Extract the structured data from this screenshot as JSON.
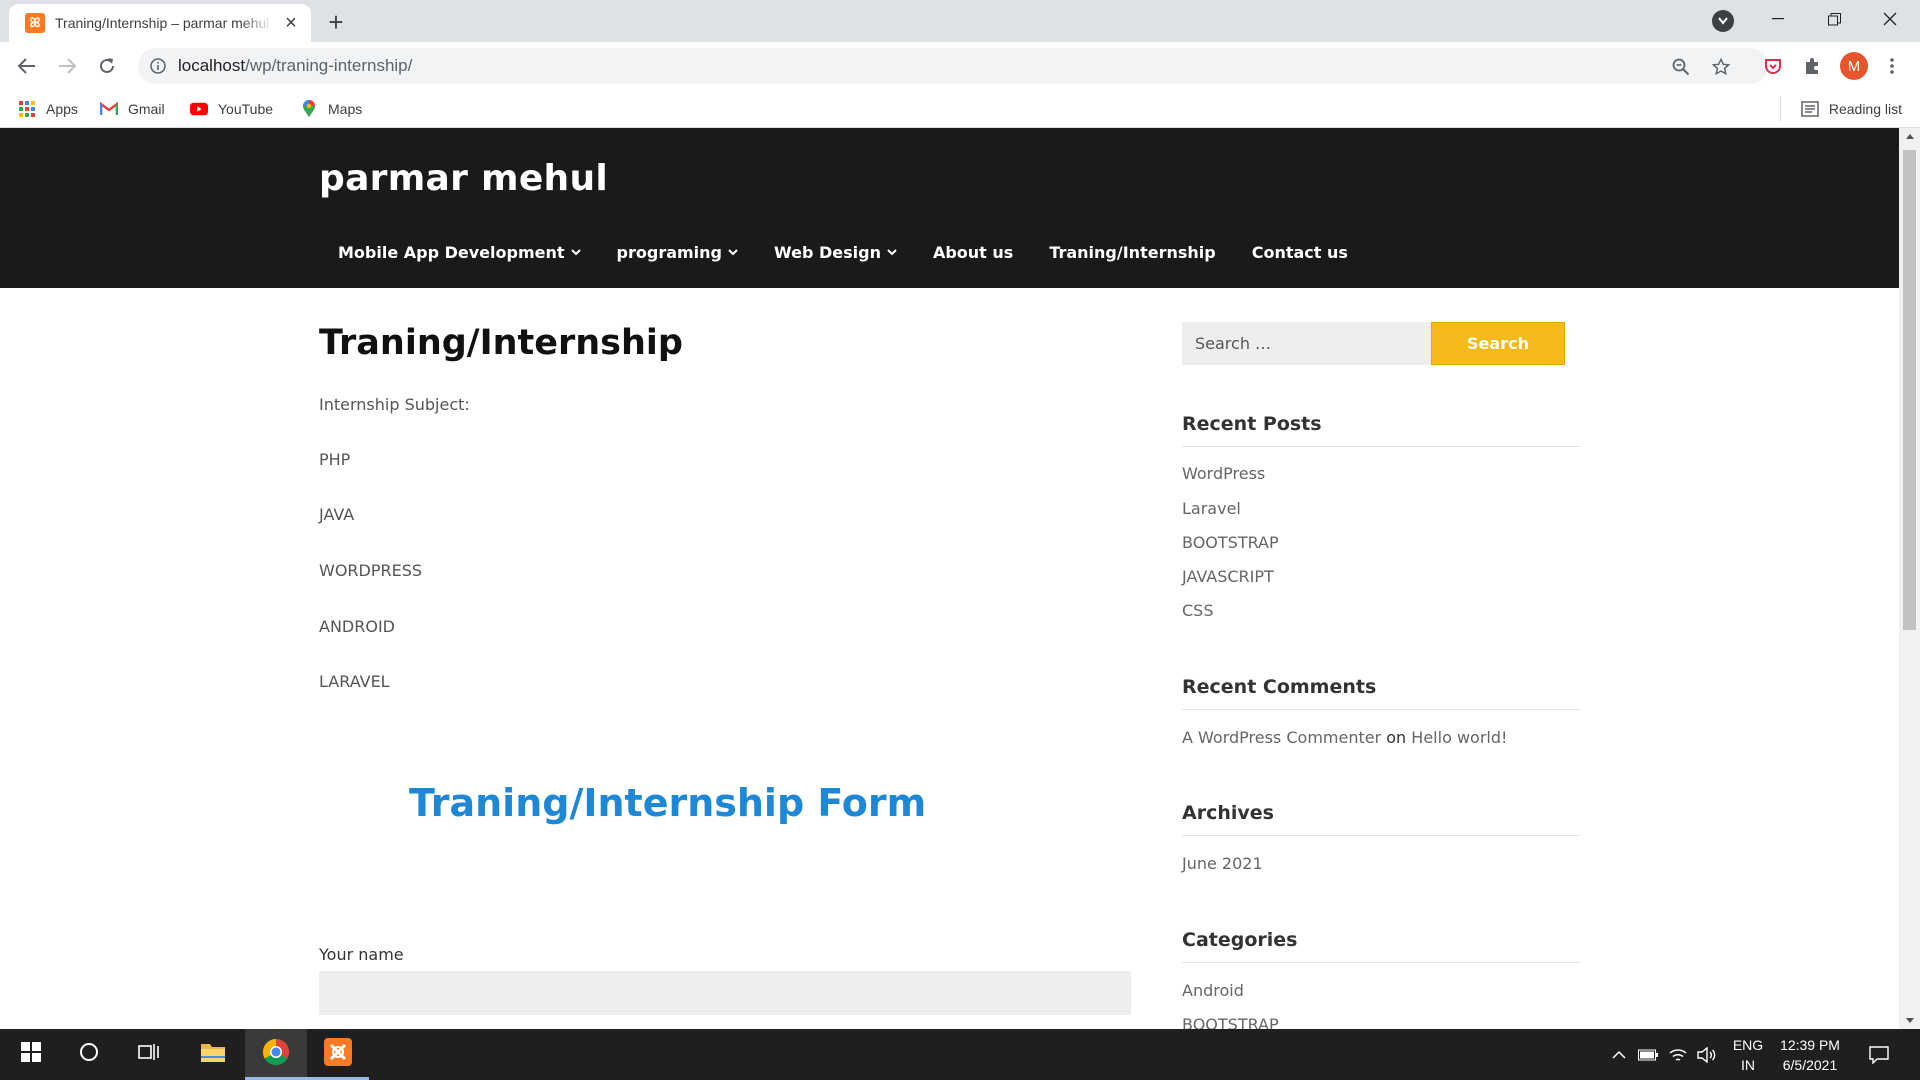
{
  "browser": {
    "tab_title": "Traning/Internship – parmar mehul",
    "url_host": "localhost",
    "url_path": "/wp/traning-internship/",
    "avatar_letter": "M",
    "bookmarks": [
      {
        "label": "Apps",
        "icon": "apps-grid-icon"
      },
      {
        "label": "Gmail",
        "icon": "gmail-icon"
      },
      {
        "label": "YouTube",
        "icon": "youtube-icon"
      },
      {
        "label": "Maps",
        "icon": "maps-icon"
      }
    ],
    "reading_list": "Reading list"
  },
  "site": {
    "title": "parmar mehul",
    "nav": [
      {
        "label": "Mobile App Development",
        "has_dropdown": true
      },
      {
        "label": "programing",
        "has_dropdown": true
      },
      {
        "label": "Web Design",
        "has_dropdown": true
      },
      {
        "label": "About us",
        "has_dropdown": false
      },
      {
        "label": "Traning/Internship",
        "has_dropdown": false
      },
      {
        "label": "Contact us",
        "has_dropdown": false
      }
    ]
  },
  "content": {
    "title": "Traning/Internship",
    "lines": [
      "Internship Subject:",
      "PHP",
      "JAVA",
      "WORDPRESS",
      "ANDROID",
      "LARAVEL"
    ],
    "form_heading": "Traning/Internship Form",
    "field_label": "Your name"
  },
  "sidebar": {
    "search_placeholder": "Search …",
    "search_button": "Search",
    "recent_posts_title": "Recent Posts",
    "recent_posts": [
      "WordPress",
      "Laravel",
      "BOOTSTRAP",
      "JAVASCRIPT",
      "CSS"
    ],
    "recent_comments_title": "Recent Comments",
    "comment": {
      "author": "A WordPress Commenter",
      "on": "on",
      "post": "Hello world!"
    },
    "archives_title": "Archives",
    "archives": [
      "June 2021"
    ],
    "categories_title": "Categories",
    "categories": [
      "Android",
      "BOOTSTRAP"
    ]
  },
  "taskbar": {
    "language": "ENG",
    "region": "IN",
    "time": "12:39 PM",
    "date": "6/5/2021"
  },
  "colors": {
    "header_bg": "#1a1a1a",
    "search_button": "#f5ba1a",
    "form_heading": "#1e88d6",
    "xampp_orange": "#fb7a24"
  }
}
